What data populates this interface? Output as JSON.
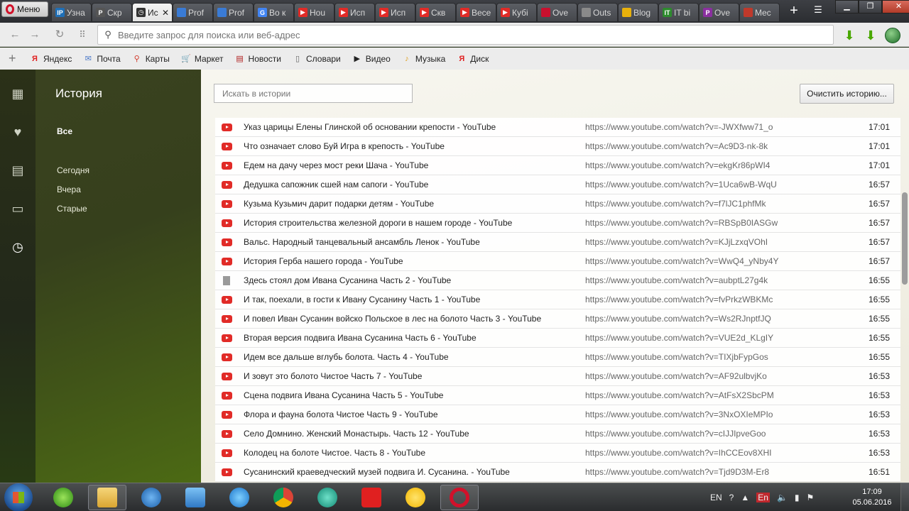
{
  "menu_label": "Меню",
  "tabs": [
    {
      "label": "Узна",
      "fav": "IP",
      "color": "#1f6fb7",
      "active": false
    },
    {
      "label": "Скр",
      "fav": "P",
      "color": "#555555",
      "active": false
    },
    {
      "label": "Ис",
      "fav": "clock",
      "color": "#333333",
      "active": true
    },
    {
      "label": "Prof",
      "fav": "chart",
      "color": "#3a7bd5",
      "active": false
    },
    {
      "label": "Prof",
      "fav": "chart",
      "color": "#3a7bd5",
      "active": false
    },
    {
      "label": "Во к",
      "fav": "G",
      "color": "#4285f4",
      "active": false
    },
    {
      "label": "Hou",
      "fav": "yt",
      "color": "#e12b27",
      "active": false
    },
    {
      "label": "Исп",
      "fav": "yt",
      "color": "#e12b27",
      "active": false
    },
    {
      "label": "Исп",
      "fav": "yt",
      "color": "#e12b27",
      "active": false
    },
    {
      "label": "Скв",
      "fav": "yt",
      "color": "#e12b27",
      "active": false
    },
    {
      "label": "Весе",
      "fav": "yt",
      "color": "#e12b27",
      "active": false
    },
    {
      "label": "Кубі",
      "fav": "yt",
      "color": "#e12b27",
      "active": false
    },
    {
      "label": "Ove",
      "fav": "flag",
      "color": "#c8102e",
      "active": false
    },
    {
      "label": "Outs",
      "fav": "doc",
      "color": "#8a8a8a",
      "active": false
    },
    {
      "label": "Blog",
      "fav": "sun",
      "color": "#e8b10c",
      "active": false
    },
    {
      "label": "IT bi",
      "fav": "IT",
      "color": "#2d8b2d",
      "active": false
    },
    {
      "label": "Ove",
      "fav": "P",
      "color": "#8b2fa0",
      "active": false
    },
    {
      "label": "Mec",
      "fav": "spiral",
      "color": "#c0392b",
      "active": false
    }
  ],
  "address_placeholder": "Введите запрос для поиска или веб-адрес",
  "bookmarks": [
    {
      "label": "Яндекс",
      "icon": "yandex-icon",
      "glyph": "Я",
      "color": "#e02020"
    },
    {
      "label": "Почта",
      "icon": "mail-icon",
      "glyph": "✉",
      "color": "#4a78c8"
    },
    {
      "label": "Карты",
      "icon": "map-pin-icon",
      "glyph": "⚲",
      "color": "#d23a2a"
    },
    {
      "label": "Маркет",
      "icon": "cart-icon",
      "glyph": "🛒",
      "color": "#3b5fa8"
    },
    {
      "label": "Новости",
      "icon": "news-icon",
      "glyph": "▤",
      "color": "#b02020"
    },
    {
      "label": "Словари",
      "icon": "dictionary-icon",
      "glyph": "▯",
      "color": "#666666"
    },
    {
      "label": "Видео",
      "icon": "video-icon",
      "glyph": "▶",
      "color": "#222222"
    },
    {
      "label": "Музыка",
      "icon": "music-icon",
      "glyph": "♪",
      "color": "#e0a020"
    },
    {
      "label": "Диск",
      "icon": "disk-icon",
      "glyph": "Я",
      "color": "#e02020"
    }
  ],
  "sidebar": {
    "title": "История",
    "items": [
      "Все",
      "Сегодня",
      "Вчера",
      "Старые"
    ]
  },
  "search_placeholder": "Искать в истории",
  "clear_button": "Очистить историю...",
  "history": [
    {
      "title": "Указ царицы Елены Глинской об основании крепости - YouTube",
      "url": "https://www.youtube.com/watch?v=-JWXfww71_o",
      "time": "17:01",
      "icon": "yt"
    },
    {
      "title": "Что означает слово Буй Игра в крепость - YouTube",
      "url": "https://www.youtube.com/watch?v=Ac9D3-nk-8k",
      "time": "17:01",
      "icon": "yt"
    },
    {
      "title": "Едем на дачу через мост реки Шача - YouTube",
      "url": "https://www.youtube.com/watch?v=ekgKr86pWI4",
      "time": "17:01",
      "icon": "yt"
    },
    {
      "title": "Дедушка сапожник сшей нам сапоги - YouTube",
      "url": "https://www.youtube.com/watch?v=1Uca6wB-WqU",
      "time": "16:57",
      "icon": "yt"
    },
    {
      "title": "Кузьма Кузьмич дарит подарки детям - YouTube",
      "url": "https://www.youtube.com/watch?v=f7lJC1phfMk",
      "time": "16:57",
      "icon": "yt"
    },
    {
      "title": "История строительства железной дороги в нашем городе - YouTube",
      "url": "https://www.youtube.com/watch?v=RBSpB0IASGw",
      "time": "16:57",
      "icon": "yt"
    },
    {
      "title": "Вальс. Народный танцевальный ансамбль Ленок - YouTube",
      "url": "https://www.youtube.com/watch?v=KJjLzxqVOhI",
      "time": "16:57",
      "icon": "yt"
    },
    {
      "title": "История Герба нашего города - YouTube",
      "url": "https://www.youtube.com/watch?v=WwQ4_yNby4Y",
      "time": "16:57",
      "icon": "yt"
    },
    {
      "title": "Здесь стоял дом Ивана Сусанина Часть 2 - YouTube",
      "url": "https://www.youtube.com/watch?v=aubptL27g4k",
      "time": "16:55",
      "icon": "doc"
    },
    {
      "title": "И так, поехали, в гости к Ивану Сусанину Часть 1 - YouTube",
      "url": "https://www.youtube.com/watch?v=fvPrkzWBKMc",
      "time": "16:55",
      "icon": "yt"
    },
    {
      "title": "И повел Иван Сусанин войско Польское в лес на болото Часть 3 - YouTube",
      "url": "https://www.youtube.com/watch?v=Ws2RJnptfJQ",
      "time": "16:55",
      "icon": "yt"
    },
    {
      "title": "Вторая версия подвига Ивана Сусанина Часть 6 - YouTube",
      "url": "https://www.youtube.com/watch?v=VUE2d_KLgIY",
      "time": "16:55",
      "icon": "yt"
    },
    {
      "title": "Идем все дальше вглубь болота. Часть 4 - YouTube",
      "url": "https://www.youtube.com/watch?v=TIXjbFypGos",
      "time": "16:55",
      "icon": "yt"
    },
    {
      "title": "И зовут это болото Чистое Часть 7 - YouTube",
      "url": "https://www.youtube.com/watch?v=AF92ulbvjKo",
      "time": "16:53",
      "icon": "yt"
    },
    {
      "title": "Сцена подвига Ивана Сусанина Часть 5 - YouTube",
      "url": "https://www.youtube.com/watch?v=AtFsX2SbcPM",
      "time": "16:53",
      "icon": "yt"
    },
    {
      "title": "Флора и фауна болота Чистое Часть 9 - YouTube",
      "url": "https://www.youtube.com/watch?v=3NxOXIeMPIo",
      "time": "16:53",
      "icon": "yt"
    },
    {
      "title": "Село Домнино. Женский Монастырь. Часть 12 - YouTube",
      "url": "https://www.youtube.com/watch?v=cIJJIpveGoo",
      "time": "16:53",
      "icon": "yt"
    },
    {
      "title": "Колодец на болоте Чистое. Часть 8 - YouTube",
      "url": "https://www.youtube.com/watch?v=IhCCEov8XHI",
      "time": "16:53",
      "icon": "yt"
    },
    {
      "title": "Сусанинский краеведческий музей подвига И. Сусанина. - YouTube",
      "url": "https://www.youtube.com/watch?v=Tjd9D3M-Er8",
      "time": "16:51",
      "icon": "yt"
    }
  ],
  "taskbar": {
    "apps": [
      "icq-icon",
      "explorer-icon",
      "mail-agent-icon",
      "speaker-app-icon",
      "ie-icon",
      "chrome-icon",
      "torrent-icon",
      "yandex-icon",
      "yandex-browser-icon",
      "opera-icon"
    ],
    "lang": "EN",
    "tray_lang": "En",
    "time": "17:09",
    "date": "05.06.2016"
  }
}
